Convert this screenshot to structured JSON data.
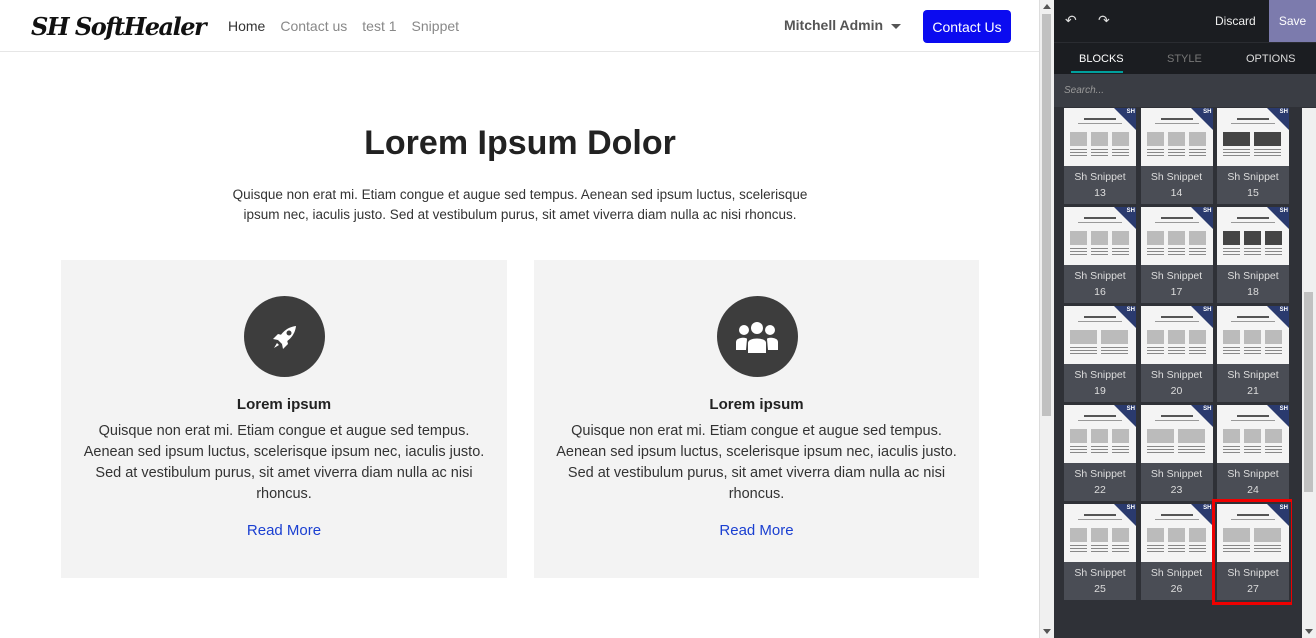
{
  "site": {
    "logo": "SH SoftHealer",
    "nav": [
      {
        "label": "Home",
        "active": true
      },
      {
        "label": "Contact us",
        "active": false
      },
      {
        "label": "test 1",
        "active": false
      },
      {
        "label": "Snippet",
        "active": false
      }
    ],
    "user": "Mitchell Admin",
    "contact_button": "Contact Us",
    "hero_title": "Lorem Ipsum Dolor",
    "hero_text": "Quisque non erat mi. Etiam congue et augue sed tempus. Aenean sed ipsum luctus, scelerisque ipsum nec, iaculis justo. Sed at vestibulum purus, sit amet viverra diam nulla ac nisi rhoncus.",
    "cards": [
      {
        "icon": "rocket-icon",
        "title": "Lorem ipsum",
        "text": "Quisque non erat mi. Etiam congue et augue sed tempus. Aenean sed ipsum luctus, scelerisque ipsum nec, iaculis justo. Sed at vestibulum purus, sit amet viverra diam nulla ac nisi rhoncus.",
        "link": "Read More"
      },
      {
        "icon": "users-icon",
        "title": "Lorem ipsum",
        "text": "Quisque non erat mi. Etiam congue et augue sed tempus. Aenean sed ipsum luctus, scelerisque ipsum nec, iaculis justo. Sed at vestibulum purus, sit amet viverra diam nulla ac nisi rhoncus.",
        "link": "Read More"
      }
    ]
  },
  "editor": {
    "discard": "Discard",
    "save": "Save",
    "tabs": {
      "blocks": "BLOCKS",
      "style": "STYLE",
      "options": "OPTIONS"
    },
    "search_placeholder": "Search...",
    "snippet_prefix": "Sh Snippet",
    "snippets": [
      "13",
      "14",
      "15",
      "16",
      "17",
      "18",
      "19",
      "20",
      "21",
      "22",
      "23",
      "24",
      "25",
      "26",
      "27"
    ],
    "selected_snippet": "27",
    "accent": "#7c7bad",
    "primary": "#0b0bf0"
  }
}
